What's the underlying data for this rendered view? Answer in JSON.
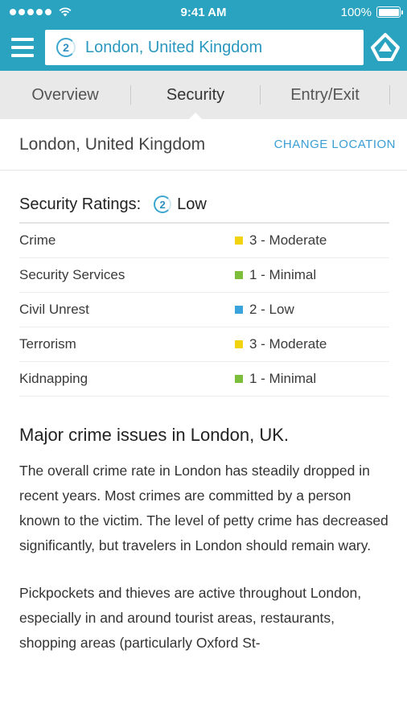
{
  "status_bar": {
    "time": "9:41 AM",
    "battery_text": "100%",
    "signal_bars": 5
  },
  "header": {
    "menu_icon": "hamburger-icon",
    "search_badge": "2",
    "search_value": "London, United Kingdom",
    "logo_icon": "app-logo-icon"
  },
  "tabs": [
    {
      "label": "Overview",
      "active": false
    },
    {
      "label": "Security",
      "active": true
    },
    {
      "label": "Entry/Exit",
      "active": false
    }
  ],
  "location": {
    "name": "London, United Kingdom",
    "change_label": "CHANGE LOCATION"
  },
  "ratings": {
    "title": "Security Ratings:",
    "overall_badge": "2",
    "overall_text": "Low",
    "rows": [
      {
        "label": "Crime",
        "value": "3 - Moderate",
        "color": "#f2d30f"
      },
      {
        "label": "Security Services",
        "value": "1 - Minimal",
        "color": "#7cbd3a"
      },
      {
        "label": "Civil Unrest",
        "value": "2 - Low",
        "color": "#3aa3dc"
      },
      {
        "label": "Terrorism",
        "value": "3 - Moderate",
        "color": "#f2d30f"
      },
      {
        "label": "Kidnapping",
        "value": "1 - Minimal",
        "color": "#7cbd3a"
      }
    ]
  },
  "article": {
    "title": "Major crime issues in London, UK.",
    "paragraphs": [
      "The overall crime rate in London has steadily dropped in recent years. Most crimes are committed by a person known to the victim. The level of petty crime has decreased significantly, but travelers in London should remain wary.",
      "Pickpockets and thieves are active throughout London, especially in and around tourist areas, restaurants, shopping areas (particularly Oxford St-"
    ]
  },
  "colors": {
    "brand": "#2aa3c0",
    "link": "#3a9dd4"
  }
}
